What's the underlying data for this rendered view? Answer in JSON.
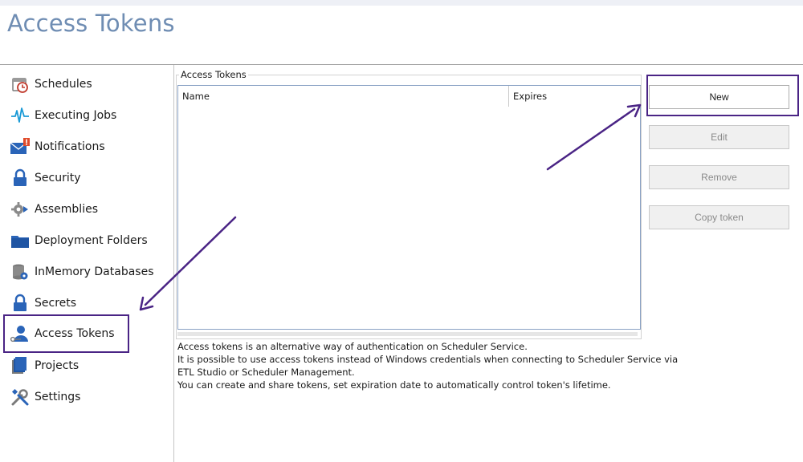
{
  "page": {
    "title": "Access Tokens"
  },
  "sidebar": {
    "items": [
      {
        "label": "Schedules",
        "icon": "clock-calendar-icon"
      },
      {
        "label": "Executing Jobs",
        "icon": "pulse-icon"
      },
      {
        "label": "Notifications",
        "icon": "envelope-alert-icon"
      },
      {
        "label": "Security",
        "icon": "lock-icon"
      },
      {
        "label": "Assemblies",
        "icon": "gear-arrow-icon"
      },
      {
        "label": "Deployment Folders",
        "icon": "folder-icon"
      },
      {
        "label": "InMemory Databases",
        "icon": "database-gear-icon"
      },
      {
        "label": "Secrets",
        "icon": "lock-icon"
      },
      {
        "label": "Access Tokens",
        "icon": "user-key-icon",
        "selected": true
      },
      {
        "label": "Projects",
        "icon": "books-icon"
      },
      {
        "label": "Settings",
        "icon": "wrench-screwdriver-icon"
      }
    ]
  },
  "tokens_panel": {
    "group_title": "Access Tokens",
    "columns": [
      "Name",
      "Expires"
    ],
    "rows": [],
    "description": [
      "Access tokens is an alternative way of authentication on Scheduler Service.",
      "It is possible to use access tokens instead of Windows credentials when connecting to Scheduler Service via",
      "ETL Studio or Scheduler Management.",
      "You can create and share tokens, set expiration date to automatically control token's lifetime."
    ]
  },
  "actions": {
    "new_label": "New",
    "edit_label": "Edit",
    "remove_label": "Remove",
    "copy_label": "Copy token"
  },
  "colors": {
    "title": "#6f8db3",
    "highlight": "#4a2485",
    "accent_blue": "#2a64b8"
  }
}
